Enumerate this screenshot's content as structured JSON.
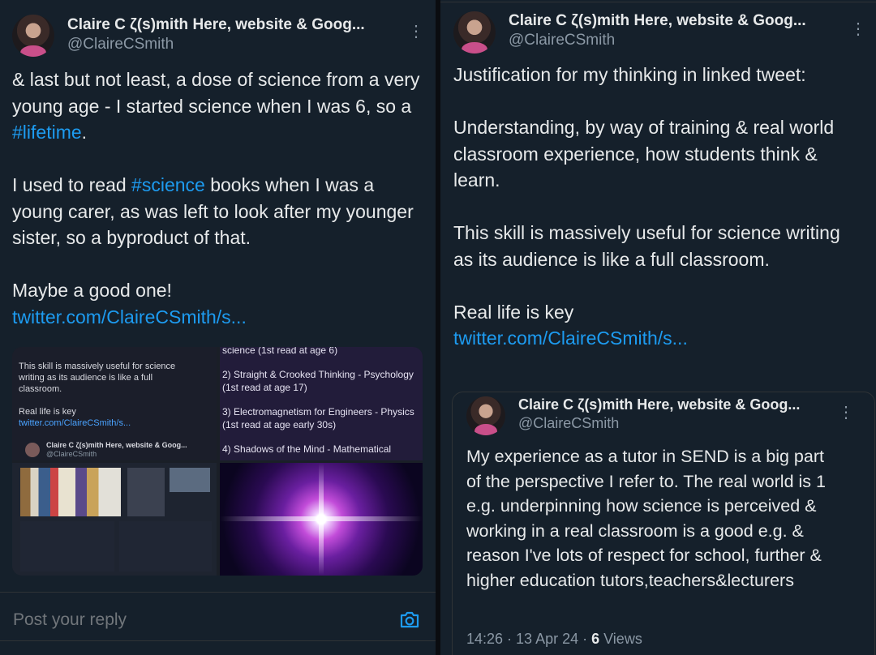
{
  "left": {
    "author": {
      "name": "Claire C ζ(s)mith Here, website & Goog...",
      "handle": "@ClaireCSmith"
    },
    "menu_icon": "more-vertical-icon",
    "para1": {
      "text": "& last but not least, a dose of science from a very young age - I started science when I was 6, so a ",
      "hashtag": "#lifetime",
      "after": "."
    },
    "para2": {
      "before": "I used to read ",
      "hashtag": "#science",
      "after": " books when I was a young carer, as was left to look after my younger sister, so a byproduct of that."
    },
    "para3": {
      "text": "Maybe a good one!",
      "link": "twitter.com/ClaireCSmith/s..."
    },
    "media": {
      "tile1": {
        "line1": "This skill is massively useful for science writing as its audience is like a full classroom.",
        "line2": "Real life is key",
        "link": "twitter.com/ClaireCSmith/s...",
        "author": "Claire C ζ(s)mith Here, website & Goog...",
        "handle": "@ClaireCSmith"
      },
      "tile2": {
        "item0": "science (1st read at age 6)",
        "item2": "2) Straight & Crooked Thinking - Psychology (1st read at age 17)",
        "item3": "3) Electromagnetism for Engineers - Physics (1st read at age early 30s)",
        "item4": "4) Shadows of the Mind - Mathematical"
      }
    },
    "reply_placeholder": "Post your reply",
    "camera_icon": "camera-icon"
  },
  "right": {
    "author": {
      "name": "Claire C ζ(s)mith Here, website & Goog...",
      "handle": "@ClaireCSmith"
    },
    "menu_icon": "more-vertical-icon",
    "para1": "Justification for my thinking in linked tweet:",
    "para2": "Understanding, by way of training & real world classroom experience, how students think & learn.",
    "para3": "This skill is massively useful for science writing as its audience is like a full classroom.",
    "para4": {
      "text": "Real life is key",
      "link": "twitter.com/ClaireCSmith/s..."
    },
    "quote": {
      "author": {
        "name": "Claire C ζ(s)mith Here, website & Goog...",
        "handle": "@ClaireCSmith"
      },
      "text": "My experience as a tutor in SEND is a big part of the perspective I refer to. The real world is 1 e.g. underpinning how science is perceived & working in a real classroom is a good e.g. & reason I've lots of respect for school, further & higher education tutors,teachers&lecturers"
    },
    "meta": {
      "time": "14:26 · 13 Apr 24 · ",
      "views_count": "6",
      "views_label": " Views"
    }
  }
}
